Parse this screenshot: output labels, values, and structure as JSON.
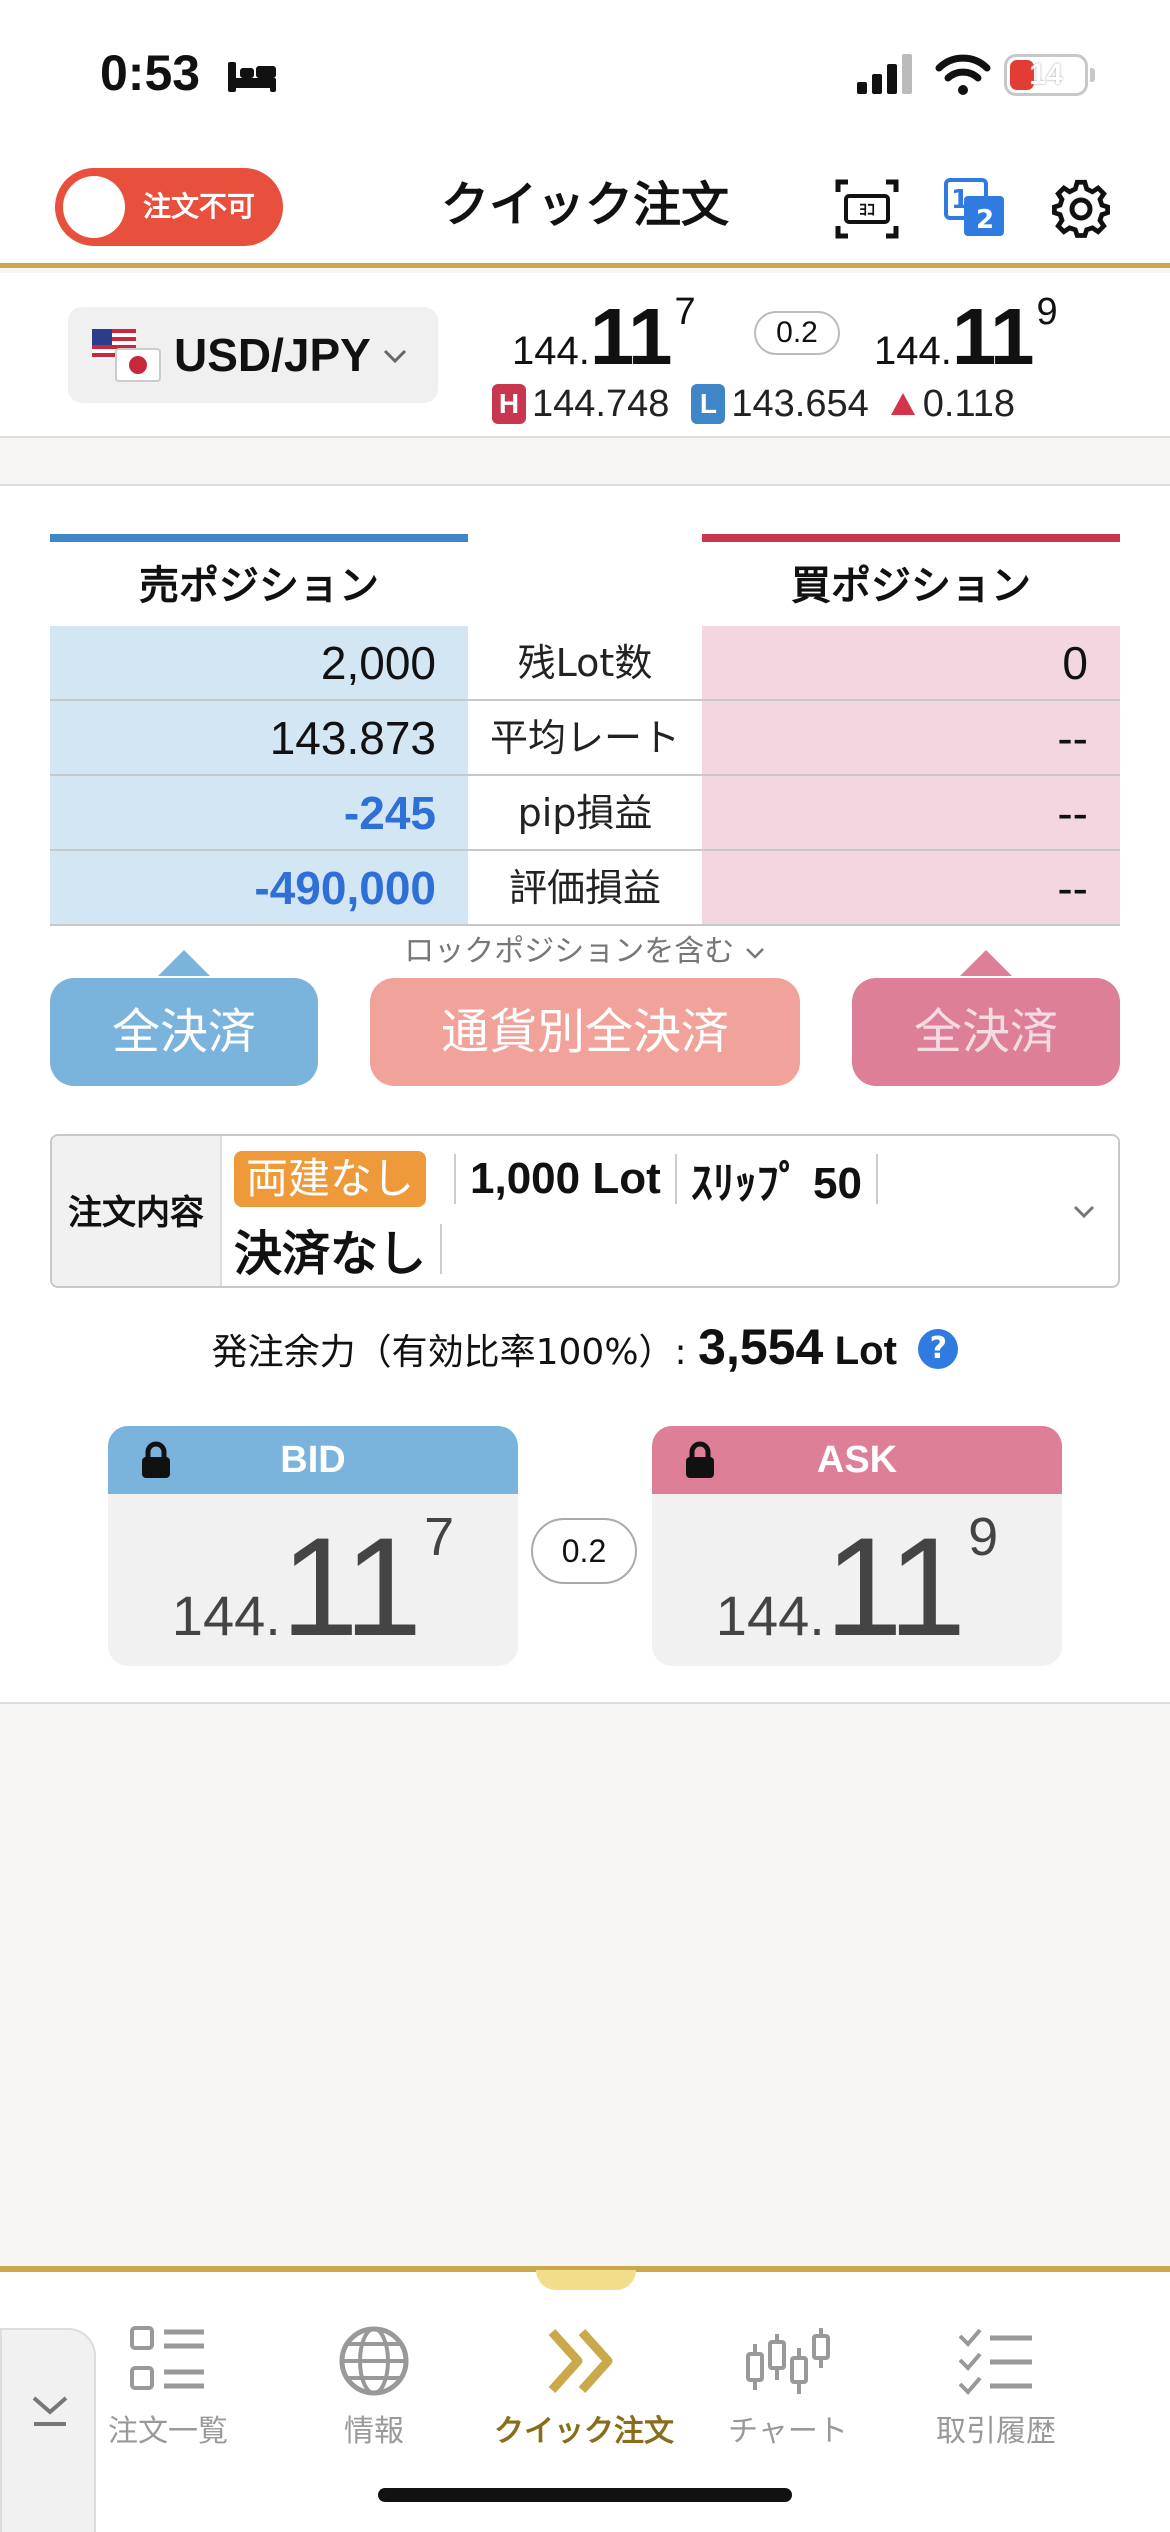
{
  "status": {
    "time": "0:53",
    "battery": "14"
  },
  "header": {
    "toggle_label": "注文不可",
    "title": "クイック注文"
  },
  "pair": {
    "name": "USD/JPY",
    "bid_small": "144.",
    "bid_big": "11",
    "bid_sup": "7",
    "spread": "0.2",
    "ask_small": "144.",
    "ask_big": "11",
    "ask_sup": "9",
    "high_badge": "H",
    "high": "144.748",
    "low_badge": "L",
    "low": "143.654",
    "change": "0.118"
  },
  "positions": {
    "sell_header": "売ポジション",
    "buy_header": "買ポジション",
    "rows": [
      {
        "label": "残Lot数",
        "sell": "2,000",
        "buy": "0"
      },
      {
        "label": "平均レート",
        "sell": "143.873",
        "buy": "--"
      },
      {
        "label": "pip損益",
        "sell": "-245",
        "buy": "--"
      },
      {
        "label": "評価損益",
        "sell": "-490,000",
        "buy": "--"
      }
    ],
    "lock_note": "ロックポジションを含む",
    "sell_close_all": "全決済",
    "currency_close_all": "通貨別全決済",
    "buy_close_all": "全決済"
  },
  "order": {
    "label": "注文内容",
    "hedge": "両建なし",
    "lot": "1,000 Lot",
    "slip": "ｽﾘｯﾌﾟ 50",
    "settle": "決済なし"
  },
  "margin": {
    "label": "発注余力（有効比率100%）:",
    "value": "3,554",
    "unit": "Lot",
    "help": "?"
  },
  "trade": {
    "bid_label": "BID",
    "ask_label": "ASK",
    "bid_small": "144.",
    "bid_big": "11",
    "bid_sup": "7",
    "ask_small": "144.",
    "ask_big": "11",
    "ask_sup": "9",
    "spread": "0.2"
  },
  "nav": [
    {
      "label": "注文一覧"
    },
    {
      "label": "情報"
    },
    {
      "label": "クイック注文"
    },
    {
      "label": "チャート"
    },
    {
      "label": "取引履歴"
    }
  ],
  "colors": {
    "sell_blue": "#3f86c9",
    "buy_red": "#c9364f",
    "gold": "#c9a94a",
    "toggle_red": "#e84f3d"
  }
}
